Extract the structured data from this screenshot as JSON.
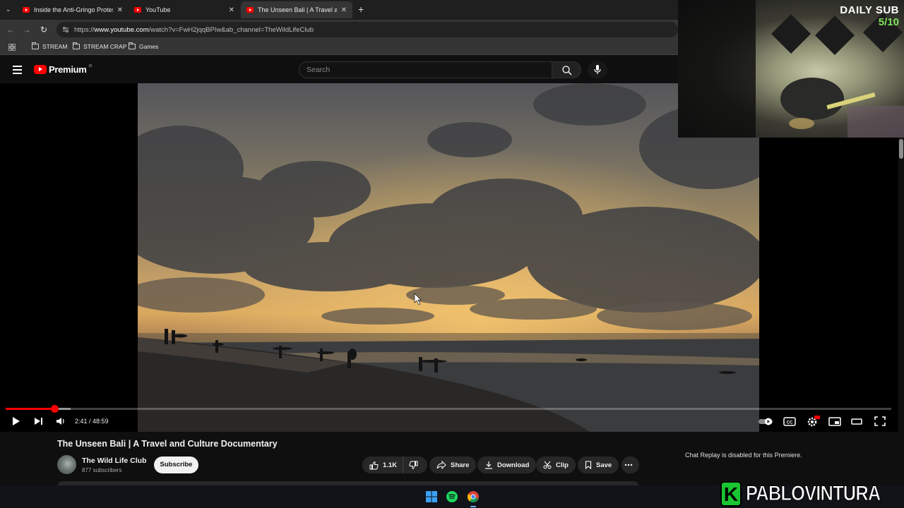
{
  "browser": {
    "tabs": [
      {
        "label": "Inside the Anti-Gringo Protests",
        "active": false
      },
      {
        "label": "YouTube",
        "active": false
      },
      {
        "label": "The Unseen Bali | A Travel and C",
        "active": true
      }
    ],
    "new_tab_label": "+",
    "url_prefix": "https://",
    "url_host": "www.youtube.com",
    "url_rest": "/watch?v=FwH2jqqBPIw&ab_channel=TheWildLifeClub",
    "bookmarks": [
      "STREAM",
      "STREAM CRAP",
      "Games"
    ]
  },
  "youtube": {
    "logo_text": "Premium",
    "logo_country": "ID",
    "search_placeholder": "Search"
  },
  "player": {
    "time_current": "2:41",
    "time_total": "48:59",
    "time_display": "2:41 / 48:59",
    "progress_played_fraction": 0.055,
    "progress_loaded_fraction": 0.073
  },
  "video_info": {
    "title": "The Unseen Bali | A Travel and Culture Documentary",
    "channel_name": "The Wild Life Club",
    "subscribers": "877 subscribers",
    "subscribe_label": "Subscribe",
    "likes": "1.1K",
    "share_label": "Share",
    "download_label": "Download",
    "clip_label": "Clip",
    "save_label": "Save"
  },
  "chat": {
    "replay_text": "Chat Replay is disabled for this Premiere."
  },
  "overlay": {
    "daily_sub_label": "DAILY SUB",
    "daily_sub_count": "5/10",
    "daily_sub_count_color": "#7ee35a",
    "brand_letter": "K",
    "brand_name": "PABLOVINTURA",
    "brand_color": "#19c532"
  },
  "colors": {
    "youtube_red": "#ff0000",
    "background": "#0f0f0f"
  }
}
